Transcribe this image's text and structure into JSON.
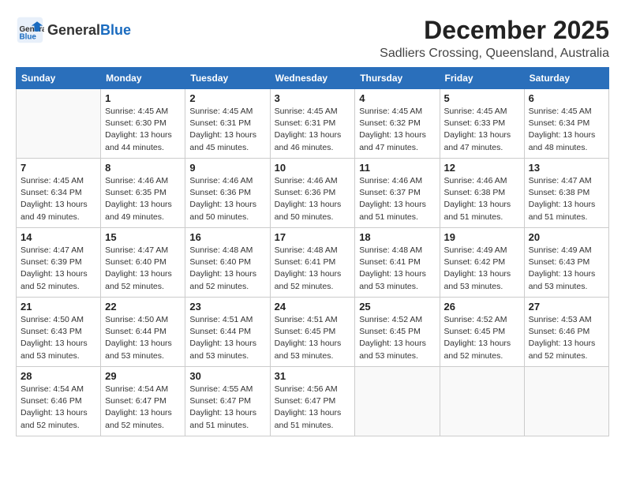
{
  "header": {
    "logo_general": "General",
    "logo_blue": "Blue",
    "month_title": "December 2025",
    "subtitle": "Sadliers Crossing, Queensland, Australia"
  },
  "weekdays": [
    "Sunday",
    "Monday",
    "Tuesday",
    "Wednesday",
    "Thursday",
    "Friday",
    "Saturday"
  ],
  "weeks": [
    [
      {
        "day": "",
        "info": ""
      },
      {
        "day": "1",
        "info": "Sunrise: 4:45 AM\nSunset: 6:30 PM\nDaylight: 13 hours\nand 44 minutes."
      },
      {
        "day": "2",
        "info": "Sunrise: 4:45 AM\nSunset: 6:31 PM\nDaylight: 13 hours\nand 45 minutes."
      },
      {
        "day": "3",
        "info": "Sunrise: 4:45 AM\nSunset: 6:31 PM\nDaylight: 13 hours\nand 46 minutes."
      },
      {
        "day": "4",
        "info": "Sunrise: 4:45 AM\nSunset: 6:32 PM\nDaylight: 13 hours\nand 47 minutes."
      },
      {
        "day": "5",
        "info": "Sunrise: 4:45 AM\nSunset: 6:33 PM\nDaylight: 13 hours\nand 47 minutes."
      },
      {
        "day": "6",
        "info": "Sunrise: 4:45 AM\nSunset: 6:34 PM\nDaylight: 13 hours\nand 48 minutes."
      }
    ],
    [
      {
        "day": "7",
        "info": "Sunrise: 4:45 AM\nSunset: 6:34 PM\nDaylight: 13 hours\nand 49 minutes."
      },
      {
        "day": "8",
        "info": "Sunrise: 4:46 AM\nSunset: 6:35 PM\nDaylight: 13 hours\nand 49 minutes."
      },
      {
        "day": "9",
        "info": "Sunrise: 4:46 AM\nSunset: 6:36 PM\nDaylight: 13 hours\nand 50 minutes."
      },
      {
        "day": "10",
        "info": "Sunrise: 4:46 AM\nSunset: 6:36 PM\nDaylight: 13 hours\nand 50 minutes."
      },
      {
        "day": "11",
        "info": "Sunrise: 4:46 AM\nSunset: 6:37 PM\nDaylight: 13 hours\nand 51 minutes."
      },
      {
        "day": "12",
        "info": "Sunrise: 4:46 AM\nSunset: 6:38 PM\nDaylight: 13 hours\nand 51 minutes."
      },
      {
        "day": "13",
        "info": "Sunrise: 4:47 AM\nSunset: 6:38 PM\nDaylight: 13 hours\nand 51 minutes."
      }
    ],
    [
      {
        "day": "14",
        "info": "Sunrise: 4:47 AM\nSunset: 6:39 PM\nDaylight: 13 hours\nand 52 minutes."
      },
      {
        "day": "15",
        "info": "Sunrise: 4:47 AM\nSunset: 6:40 PM\nDaylight: 13 hours\nand 52 minutes."
      },
      {
        "day": "16",
        "info": "Sunrise: 4:48 AM\nSunset: 6:40 PM\nDaylight: 13 hours\nand 52 minutes."
      },
      {
        "day": "17",
        "info": "Sunrise: 4:48 AM\nSunset: 6:41 PM\nDaylight: 13 hours\nand 52 minutes."
      },
      {
        "day": "18",
        "info": "Sunrise: 4:48 AM\nSunset: 6:41 PM\nDaylight: 13 hours\nand 53 minutes."
      },
      {
        "day": "19",
        "info": "Sunrise: 4:49 AM\nSunset: 6:42 PM\nDaylight: 13 hours\nand 53 minutes."
      },
      {
        "day": "20",
        "info": "Sunrise: 4:49 AM\nSunset: 6:43 PM\nDaylight: 13 hours\nand 53 minutes."
      }
    ],
    [
      {
        "day": "21",
        "info": "Sunrise: 4:50 AM\nSunset: 6:43 PM\nDaylight: 13 hours\nand 53 minutes."
      },
      {
        "day": "22",
        "info": "Sunrise: 4:50 AM\nSunset: 6:44 PM\nDaylight: 13 hours\nand 53 minutes."
      },
      {
        "day": "23",
        "info": "Sunrise: 4:51 AM\nSunset: 6:44 PM\nDaylight: 13 hours\nand 53 minutes."
      },
      {
        "day": "24",
        "info": "Sunrise: 4:51 AM\nSunset: 6:45 PM\nDaylight: 13 hours\nand 53 minutes."
      },
      {
        "day": "25",
        "info": "Sunrise: 4:52 AM\nSunset: 6:45 PM\nDaylight: 13 hours\nand 53 minutes."
      },
      {
        "day": "26",
        "info": "Sunrise: 4:52 AM\nSunset: 6:45 PM\nDaylight: 13 hours\nand 52 minutes."
      },
      {
        "day": "27",
        "info": "Sunrise: 4:53 AM\nSunset: 6:46 PM\nDaylight: 13 hours\nand 52 minutes."
      }
    ],
    [
      {
        "day": "28",
        "info": "Sunrise: 4:54 AM\nSunset: 6:46 PM\nDaylight: 13 hours\nand 52 minutes."
      },
      {
        "day": "29",
        "info": "Sunrise: 4:54 AM\nSunset: 6:47 PM\nDaylight: 13 hours\nand 52 minutes."
      },
      {
        "day": "30",
        "info": "Sunrise: 4:55 AM\nSunset: 6:47 PM\nDaylight: 13 hours\nand 51 minutes."
      },
      {
        "day": "31",
        "info": "Sunrise: 4:56 AM\nSunset: 6:47 PM\nDaylight: 13 hours\nand 51 minutes."
      },
      {
        "day": "",
        "info": ""
      },
      {
        "day": "",
        "info": ""
      },
      {
        "day": "",
        "info": ""
      }
    ]
  ]
}
